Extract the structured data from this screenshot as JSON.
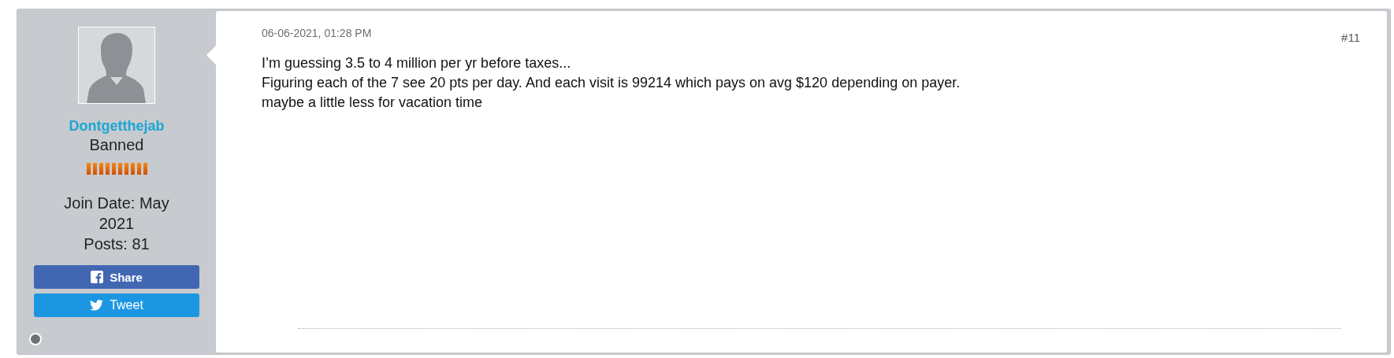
{
  "user": {
    "name": "Dontgetthejab",
    "title": "Banned",
    "join_date": "Join Date: May 2021",
    "posts": "Posts: 81",
    "online": false
  },
  "share_buttons": [
    {
      "kind": "facebook",
      "label": "Share"
    },
    {
      "kind": "twitter",
      "label": "Tweet"
    }
  ],
  "post": {
    "date": "06-06-2021, 01:28 PM",
    "number": "#11",
    "lines": [
      "I’m guessing 3.5 to 4 million per yr before taxes...",
      "Figuring each of the 7 see 20 pts per day. And each visit is 99214 which pays on avg $120 depending on payer.",
      "maybe a little less for vacation time"
    ]
  }
}
